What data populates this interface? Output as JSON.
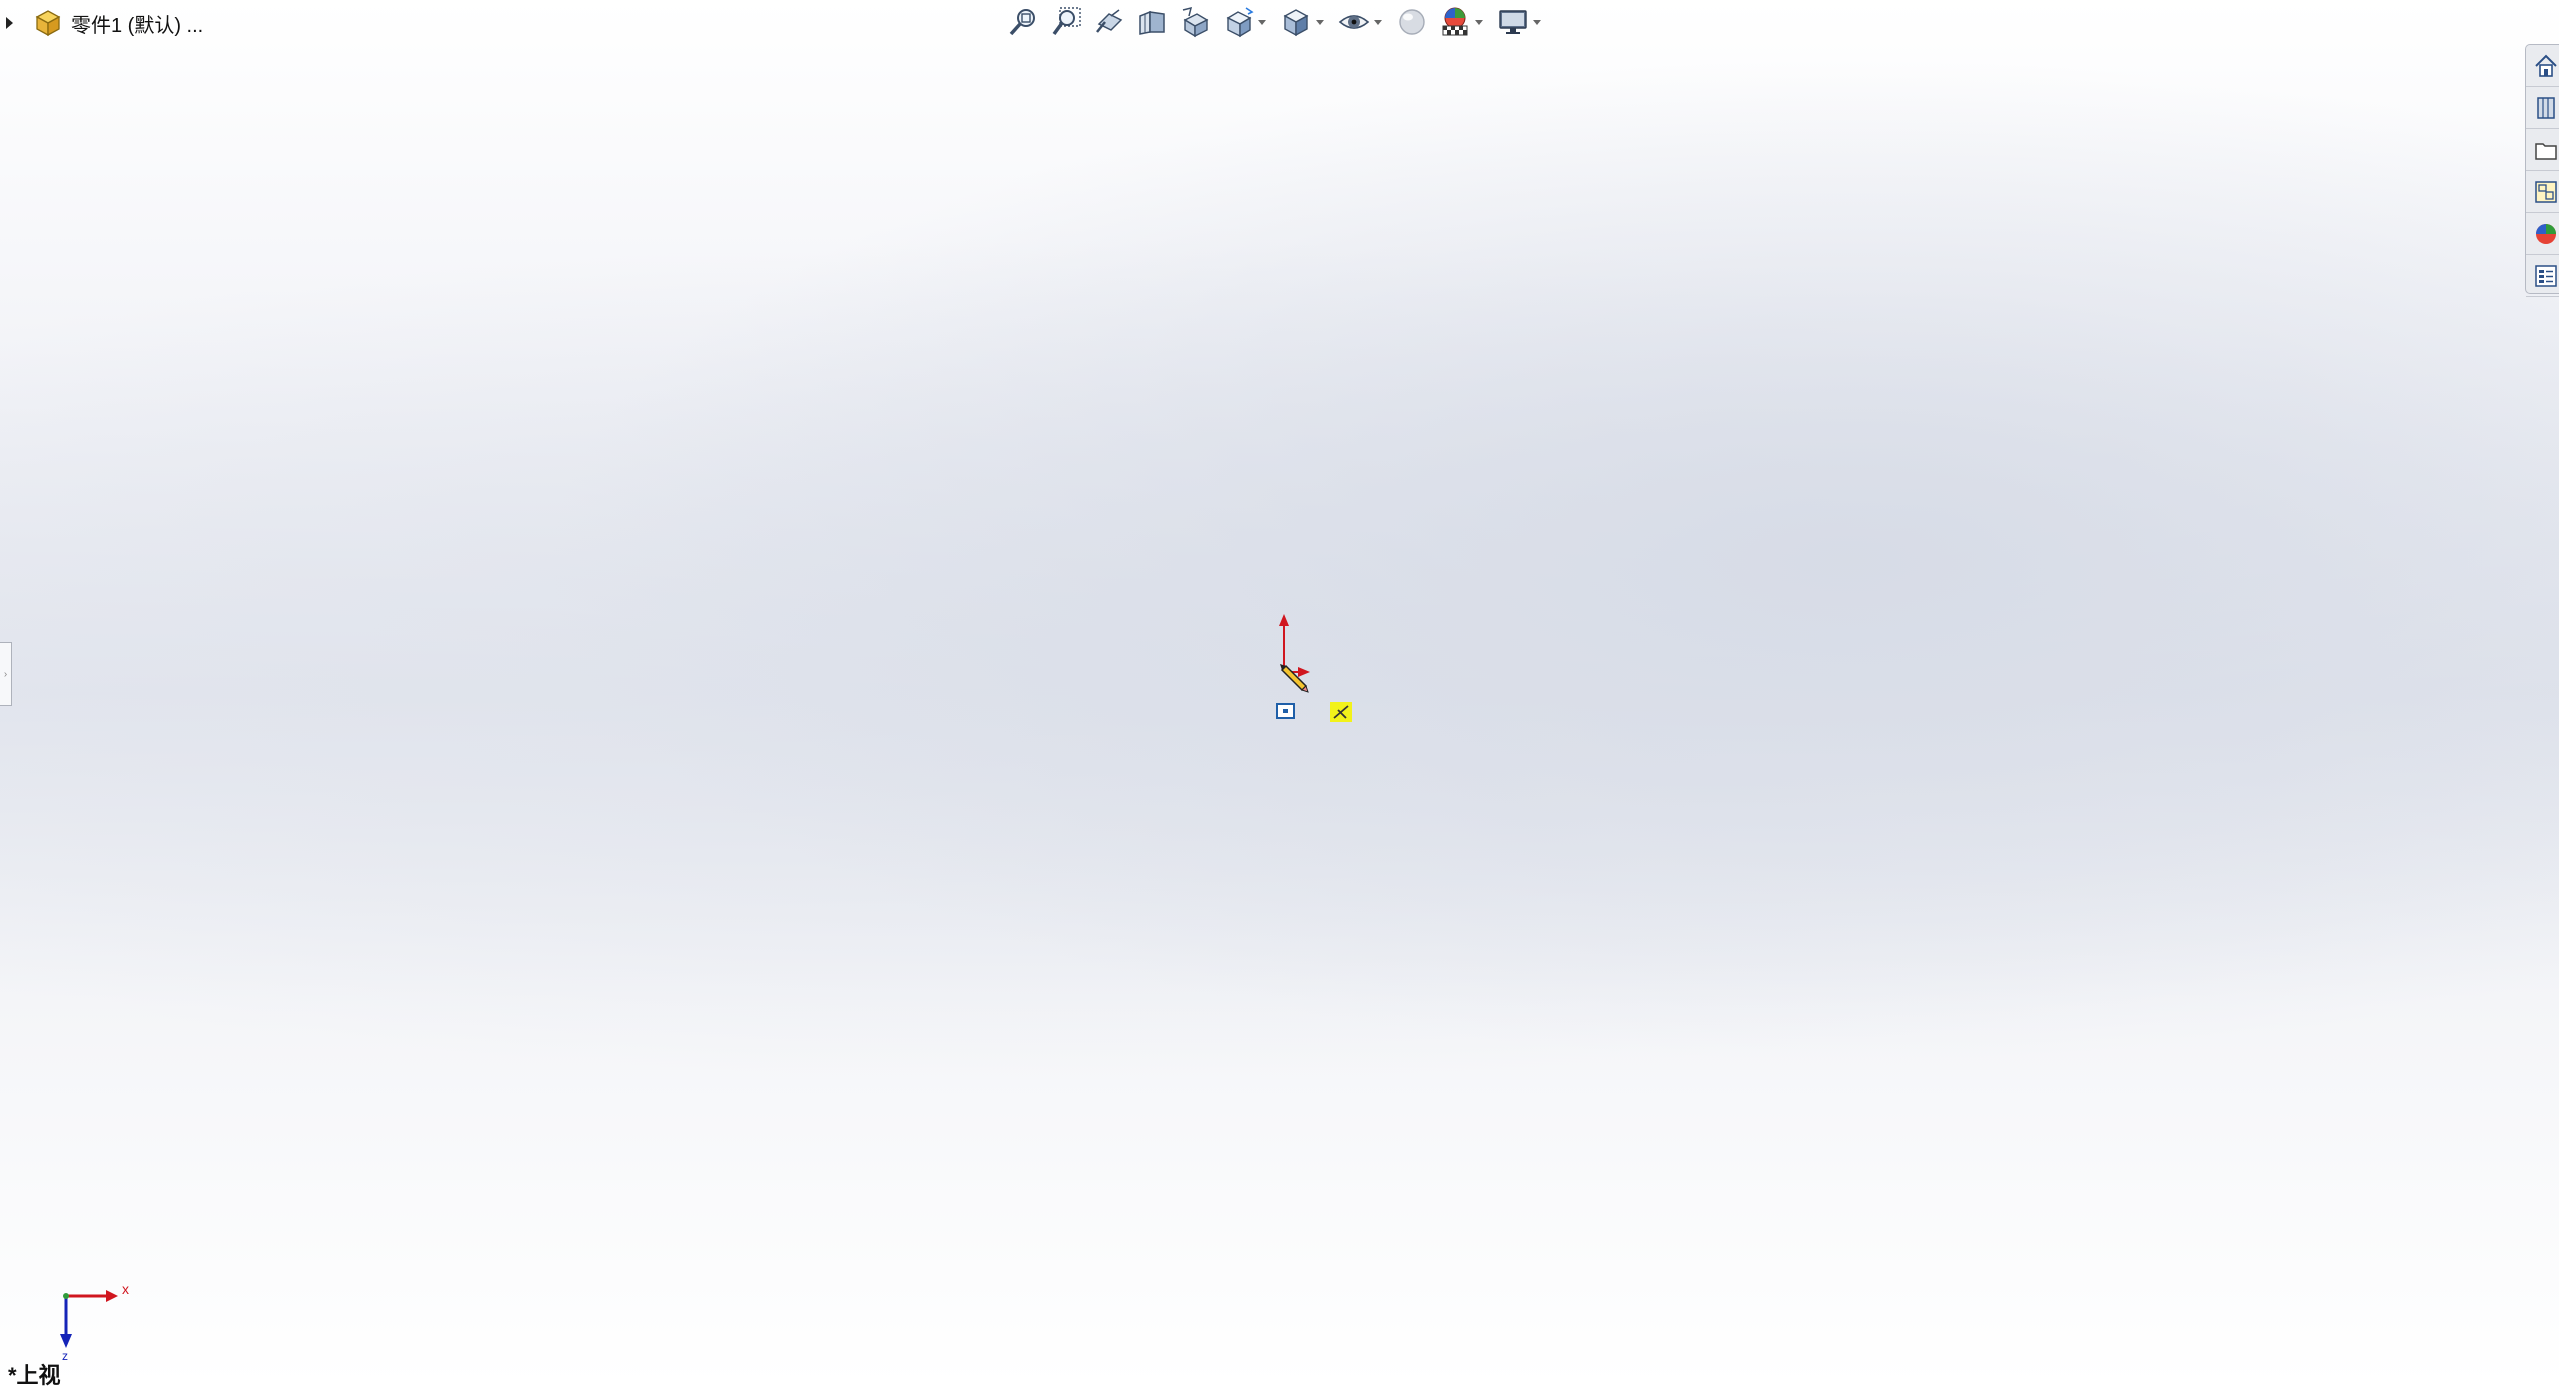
{
  "feature_tree": {
    "part_name": "零件1 (默认) ..."
  },
  "toolbar": {
    "buttons": [
      {
        "name": "zoom-to-fit-icon"
      },
      {
        "name": "zoom-to-area-icon"
      },
      {
        "name": "previous-view-icon"
      },
      {
        "name": "section-view-icon"
      },
      {
        "name": "dynamic-annotation-views-icon"
      },
      {
        "name": "view-orientation-icon",
        "dropdown": true
      },
      {
        "name": "display-style-icon",
        "dropdown": true
      },
      {
        "name": "hide-show-items-icon",
        "dropdown": true
      },
      {
        "name": "edit-appearance-icon"
      },
      {
        "name": "apply-scene-icon",
        "dropdown": true
      },
      {
        "name": "view-settings-icon",
        "dropdown": true
      }
    ]
  },
  "task_pane": {
    "tabs": [
      "home-icon",
      "design-library-icon",
      "file-explorer-icon",
      "view-palette-icon",
      "appearances-icon",
      "custom-properties-icon"
    ]
  },
  "triad": {
    "x_label": "x",
    "z_label": "z"
  },
  "view": {
    "label": "*上视"
  },
  "colors": {
    "axis_red": "#d0161f",
    "axis_blue": "#1524b8",
    "highlight_yellow": "#f2f21a"
  }
}
